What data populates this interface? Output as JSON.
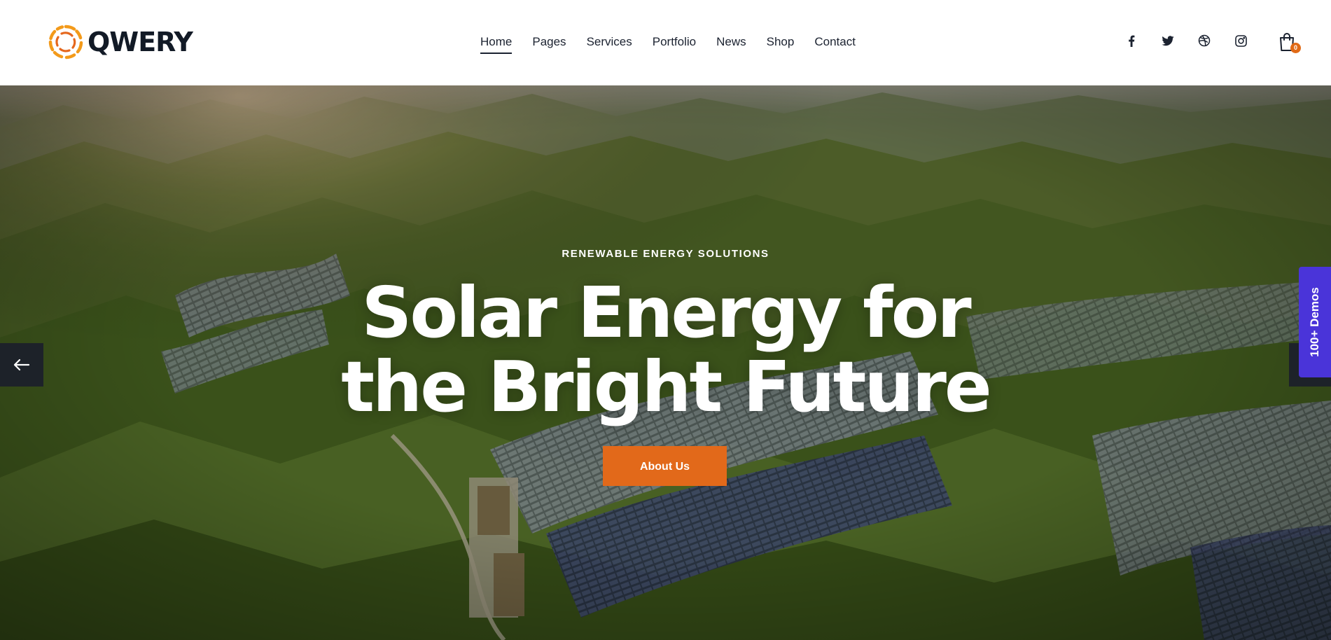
{
  "brand": {
    "name": "QWERY",
    "accent": "#e2691a",
    "demos_accent": "#4a34d9"
  },
  "nav": {
    "items": [
      {
        "label": "Home",
        "active": true
      },
      {
        "label": "Pages"
      },
      {
        "label": "Services"
      },
      {
        "label": "Portfolio"
      },
      {
        "label": "News"
      },
      {
        "label": "Shop"
      },
      {
        "label": "Contact"
      }
    ]
  },
  "social": [
    "facebook-icon",
    "twitter-icon",
    "dribbble-icon",
    "instagram-icon"
  ],
  "cart": {
    "icon": "shopping-bag-icon",
    "count": "0"
  },
  "hero": {
    "eyebrow": "RENEWABLE ENERGY SOLUTIONS",
    "title_line1": "Solar Energy for",
    "title_line2": "the Bright Future",
    "cta_label": "About Us",
    "prev_icon": "arrow-left-icon",
    "background": "aerial photo of green mountains covered with solar panel fields"
  },
  "demos_tab": {
    "label": "100+ Demos"
  }
}
